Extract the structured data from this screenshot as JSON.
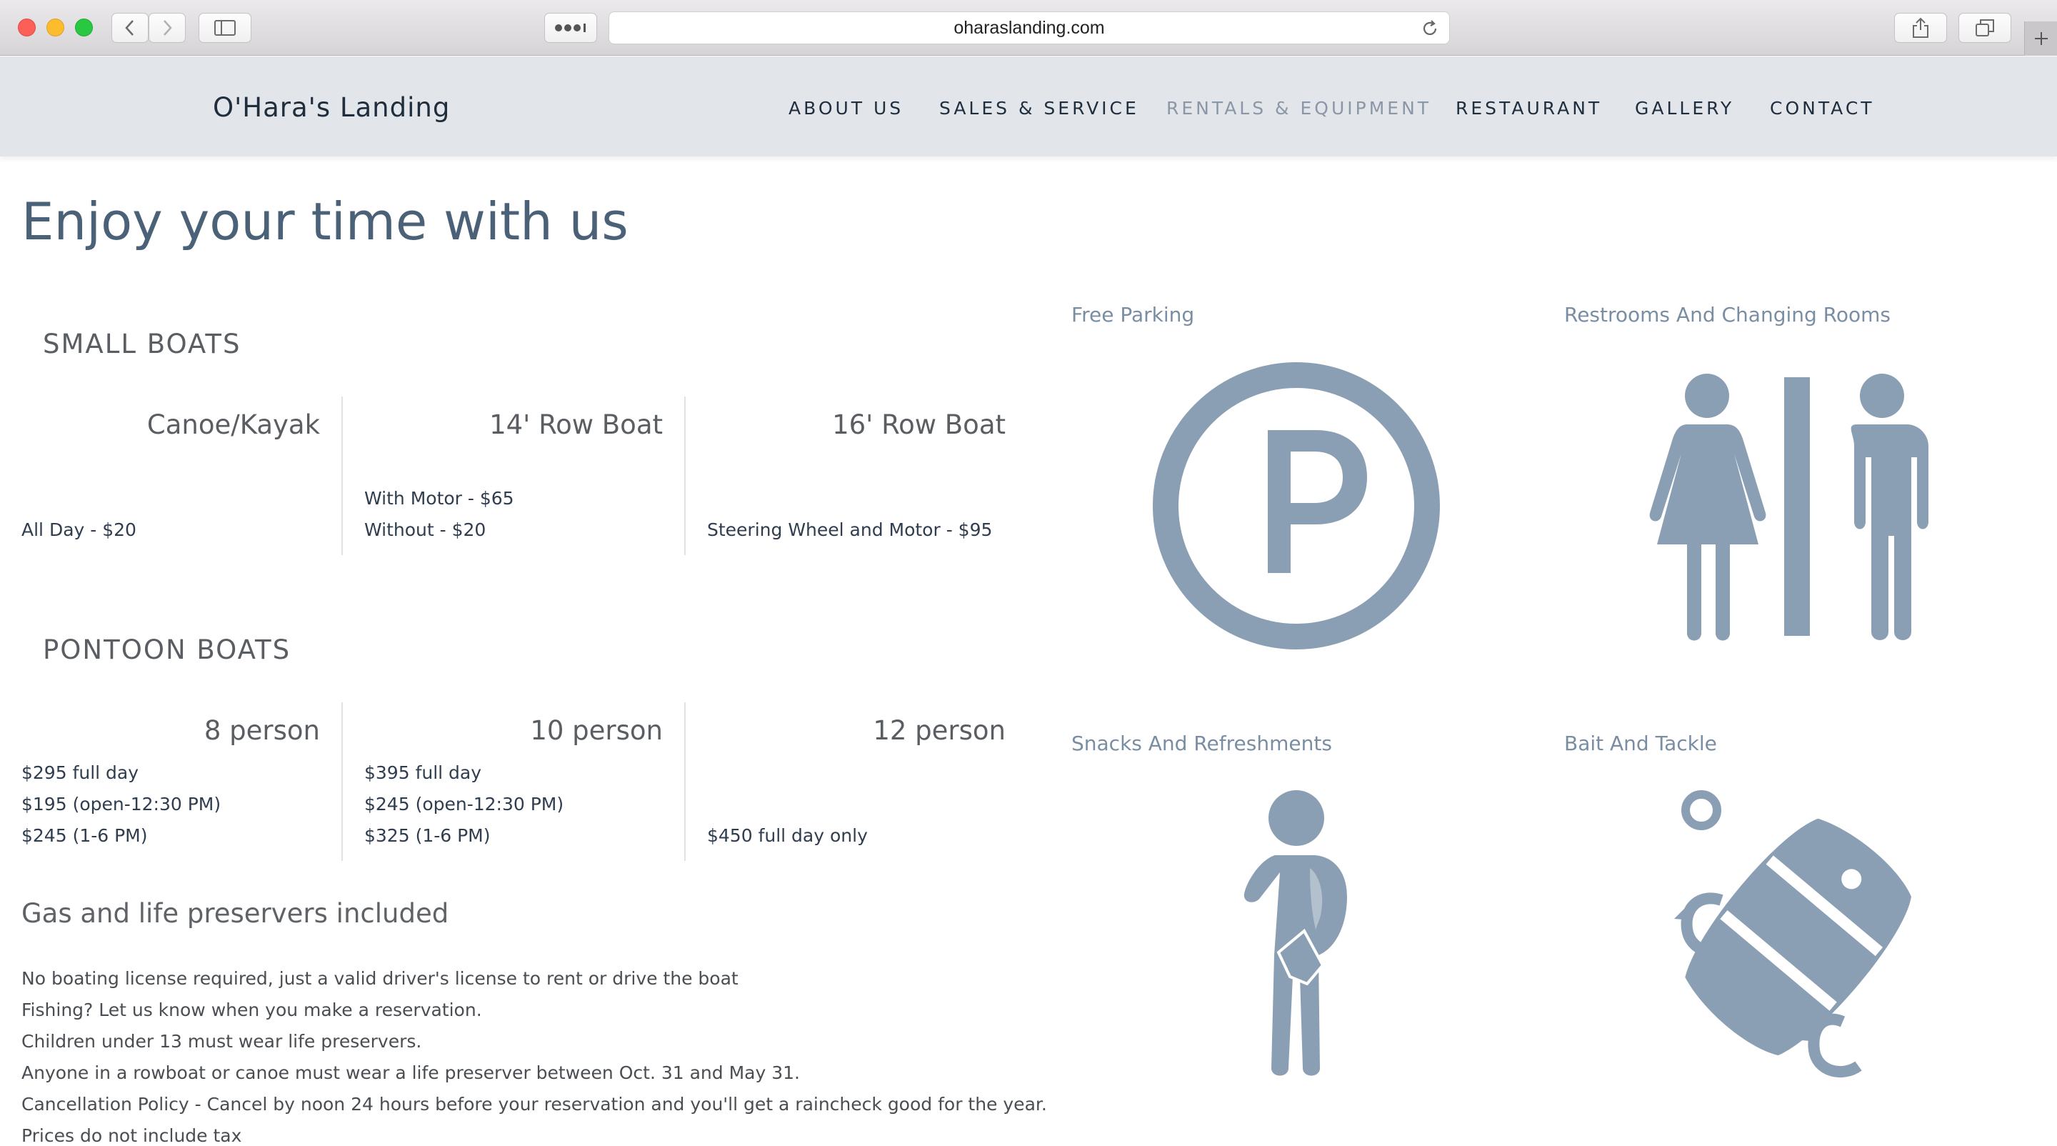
{
  "browser": {
    "url": "oharaslanding.com"
  },
  "site": {
    "logo": "O'Hara's Landing",
    "nav": [
      {
        "label": "ABOUT US",
        "active": false
      },
      {
        "label": "SALES & SERVICE",
        "active": false
      },
      {
        "label": "RENTALS & EQUIPMENT",
        "active": true
      },
      {
        "label": "RESTAURANT",
        "active": false
      },
      {
        "label": "GALLERY",
        "active": false
      },
      {
        "label": "CONTACT",
        "active": false
      }
    ]
  },
  "main": {
    "title": "Enjoy your time with us",
    "small_boats": {
      "heading": "SMALL BOATS",
      "items": [
        {
          "name": "Canoe/Kayak",
          "prices": [
            "All Day - $20"
          ]
        },
        {
          "name": "14' Row Boat",
          "prices": [
            "With Motor - $65",
            "Without - $20"
          ]
        },
        {
          "name": "16' Row Boat",
          "prices": [
            "Steering Wheel and Motor - $95"
          ]
        }
      ]
    },
    "pontoon_boats": {
      "heading": "PONTOON BOATS",
      "items": [
        {
          "name": "8 person",
          "prices": [
            "$295 full day",
            "$195 (open-12:30 PM)",
            "$245 (1-6 PM)"
          ]
        },
        {
          "name": "10 person",
          "prices": [
            "$395 full day",
            "$245 (open-12:30 PM)",
            "$325 (1-6 PM)"
          ]
        },
        {
          "name": "12 person",
          "prices": [
            "$450 full day only"
          ]
        }
      ]
    },
    "included_heading": "Gas and life preservers included",
    "notes": [
      "No boating license required, just a valid driver's license to rent or drive the boat",
      "Fishing? Let us know when you make a reservation.",
      "Children under 13 must wear life preservers.",
      "Anyone in a rowboat or canoe must wear a life preserver between Oct. 31 and May 31.",
      "Cancellation Policy - Cancel by noon 24 hours before your reservation and you'll get a raincheck good for the year.",
      "Prices do not include tax"
    ]
  },
  "amenities": [
    {
      "label": "Free Parking",
      "icon": "parking-icon"
    },
    {
      "label": "Restrooms And Changing Rooms",
      "icon": "restroom-icon"
    },
    {
      "label": "Snacks And Refreshments",
      "icon": "snacks-person-icon"
    },
    {
      "label": "Bait And Tackle",
      "icon": "fishing-lure-icon"
    }
  ],
  "colors": {
    "header_bg": "#e2e5ea",
    "nav_active": "#8b97a6",
    "title": "#4a6177",
    "icon": "#8b9fb4"
  }
}
